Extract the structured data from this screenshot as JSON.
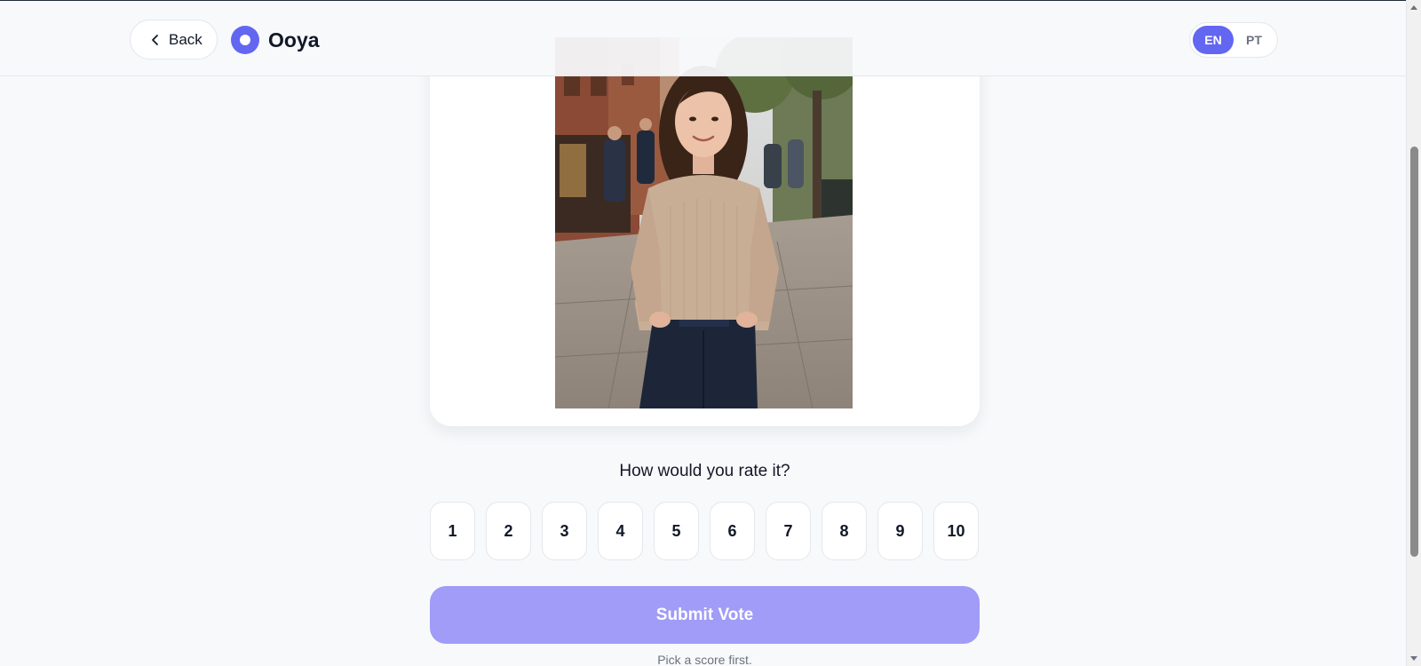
{
  "header": {
    "back_label": "Back",
    "brand_name": "Ooya",
    "languages": [
      {
        "code": "EN",
        "active": true
      },
      {
        "code": "PT",
        "active": false
      }
    ]
  },
  "photo": {
    "subject": "woman-in-beige-sweater-on-street"
  },
  "rating": {
    "question": "How would you rate it?",
    "scores": [
      "1",
      "2",
      "3",
      "4",
      "5",
      "6",
      "7",
      "8",
      "9",
      "10"
    ],
    "selected": null
  },
  "submit": {
    "label": "Submit Vote",
    "enabled": false,
    "hint": "Pick a score first."
  },
  "colors": {
    "accent": "#6366f1",
    "submit_disabled": "#a09cf7",
    "background": "#f8f9fb"
  }
}
